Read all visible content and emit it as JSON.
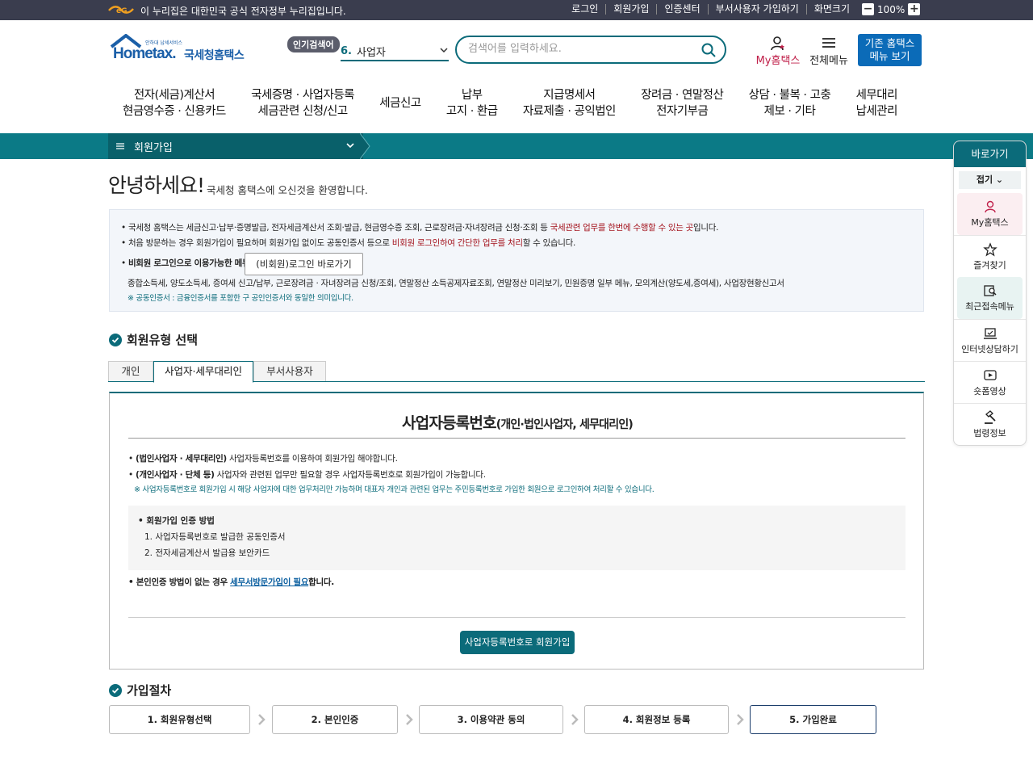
{
  "gov": {
    "text": "이 누리집은 대한민국 공식 전자정부 누리집입니다.",
    "links": [
      "로그인",
      "회원가입",
      "인증센터",
      "부서사용자 가입하기",
      "화면크기"
    ],
    "zoom": "100%",
    "zoom_minus": "−",
    "zoom_plus": "+"
  },
  "header": {
    "logo_small": "안하대 납세서비스",
    "logo_main": "Hometax.",
    "logo_kor": "국세청홈택스",
    "popular_tag": "인기검색어",
    "popular_num": "6.",
    "popular_term": "사업자",
    "search_placeholder": "검색어를 입력하세요.",
    "my_hometax": "My홈택스",
    "all_menu": "전체메뉴",
    "old_menu": "기존 홈택스\n메뉴 보기"
  },
  "gnb": [
    "전자(세금)계산서\n현금영수증 · 신용카드",
    "국세증명 · 사업자등록\n세금관련 신청/신고",
    "세금신고",
    "납부\n고지 · 환급",
    "지급명세서\n자료제출 · 공익법인",
    "장려금 · 연말정산\n전자기부금",
    "상담 · 불복 · 고충\n제보 · 기타",
    "세무대리\n납세관리"
  ],
  "breadcrumb": {
    "label": "회원가입"
  },
  "quick": {
    "title": "바로가기",
    "fold": "접기 ⌄",
    "items": [
      "My홈택스",
      "즐겨찾기",
      "최근접속메뉴",
      "인터넷상담하기",
      "숏폼영상",
      "법령정보"
    ]
  },
  "greeting": {
    "title": "안녕하세요!",
    "sub": "국세청 홈택스에 오신것을 환영합니다."
  },
  "info": {
    "l1_a": "국세청 홈택스는 세금신고·납부·증명발급, 전자세금계산서 조회·발급, 현금영수증 조회, 근로장려금·자녀장려금 신청·조회 등 ",
    "l1_red": "국세관련 업무를 한번에 수행할 수 있는 곳",
    "l1_b": "입니다.",
    "l2_a": "처음 방문하는 경우 회원가입이 필요하며 회원가입 없이도 공동인증서 등으로 ",
    "l2_red": "비회원 로그인하여 간단한 업무를 처리",
    "l2_b": "할 수 있습니다.",
    "l3": "비회원 로그인으로 이용가능한 메뉴",
    "nonmember_btn": "(비회원)로그인 바로가기",
    "l4": "종합소득세, 양도소득세, 증여세 신고/납부, 근로장려금 · 자녀장려금 신청/조회, 연말정산 소득공제자료조회, 연말정산 미리보기, 민원증명 일부 메뉴, 모의계산(양도세,증여세), 사업장현황신고서",
    "l5": "※ 공동인증서 : 금융인증서를 포함한 구 공인인증서와 동일한 의미입니다."
  },
  "member_type": {
    "heading": "회원유형 선택",
    "tabs": [
      "개인",
      "사업자·세무대리인",
      "부서사용자"
    ]
  },
  "panel": {
    "title": "사업자등록번호",
    "title_sub": "(개인·법인사업자, 세무대리인)",
    "b1_bold": "(법인사업자 · 세무대리인)",
    "b1": " 사업자등록번호를 이용하여 회원가입 해야합니다.",
    "b2_bold": "(개인사업자 · 단체 등)",
    "b2": " 사업자와 관련된 업무만 필요할 경우 사업자등록번호로 회원가입이 가능합니다.",
    "note": "※ 사업자등록번호로 회원가입 시 해당 사업자에 대한 업무처리만 가능하며 대표자 개인과 관련된 업무는 주민등록번호로 가입한 회원으로 로그인하여 처리할 수 있습니다.",
    "method_title": "회원가입 인증 방법",
    "method_1": "1. 사업자등록번호로 발급한 공동인증서",
    "method_2": "2. 전자세금계산서 발급용 보안카드",
    "visit_a": "본인인증 방법이 없는 경우 ",
    "visit_link": "세무서방문가입이 필요",
    "visit_b": "합니다.",
    "join_btn": "사업자등록번호로 회원가입"
  },
  "procedure": {
    "heading": "가입절차",
    "steps": [
      "1. 회원유형선택",
      "2. 본인인증",
      "3. 이용약관 동의",
      "4. 회원정보 등록",
      "5. 가입완료"
    ]
  }
}
